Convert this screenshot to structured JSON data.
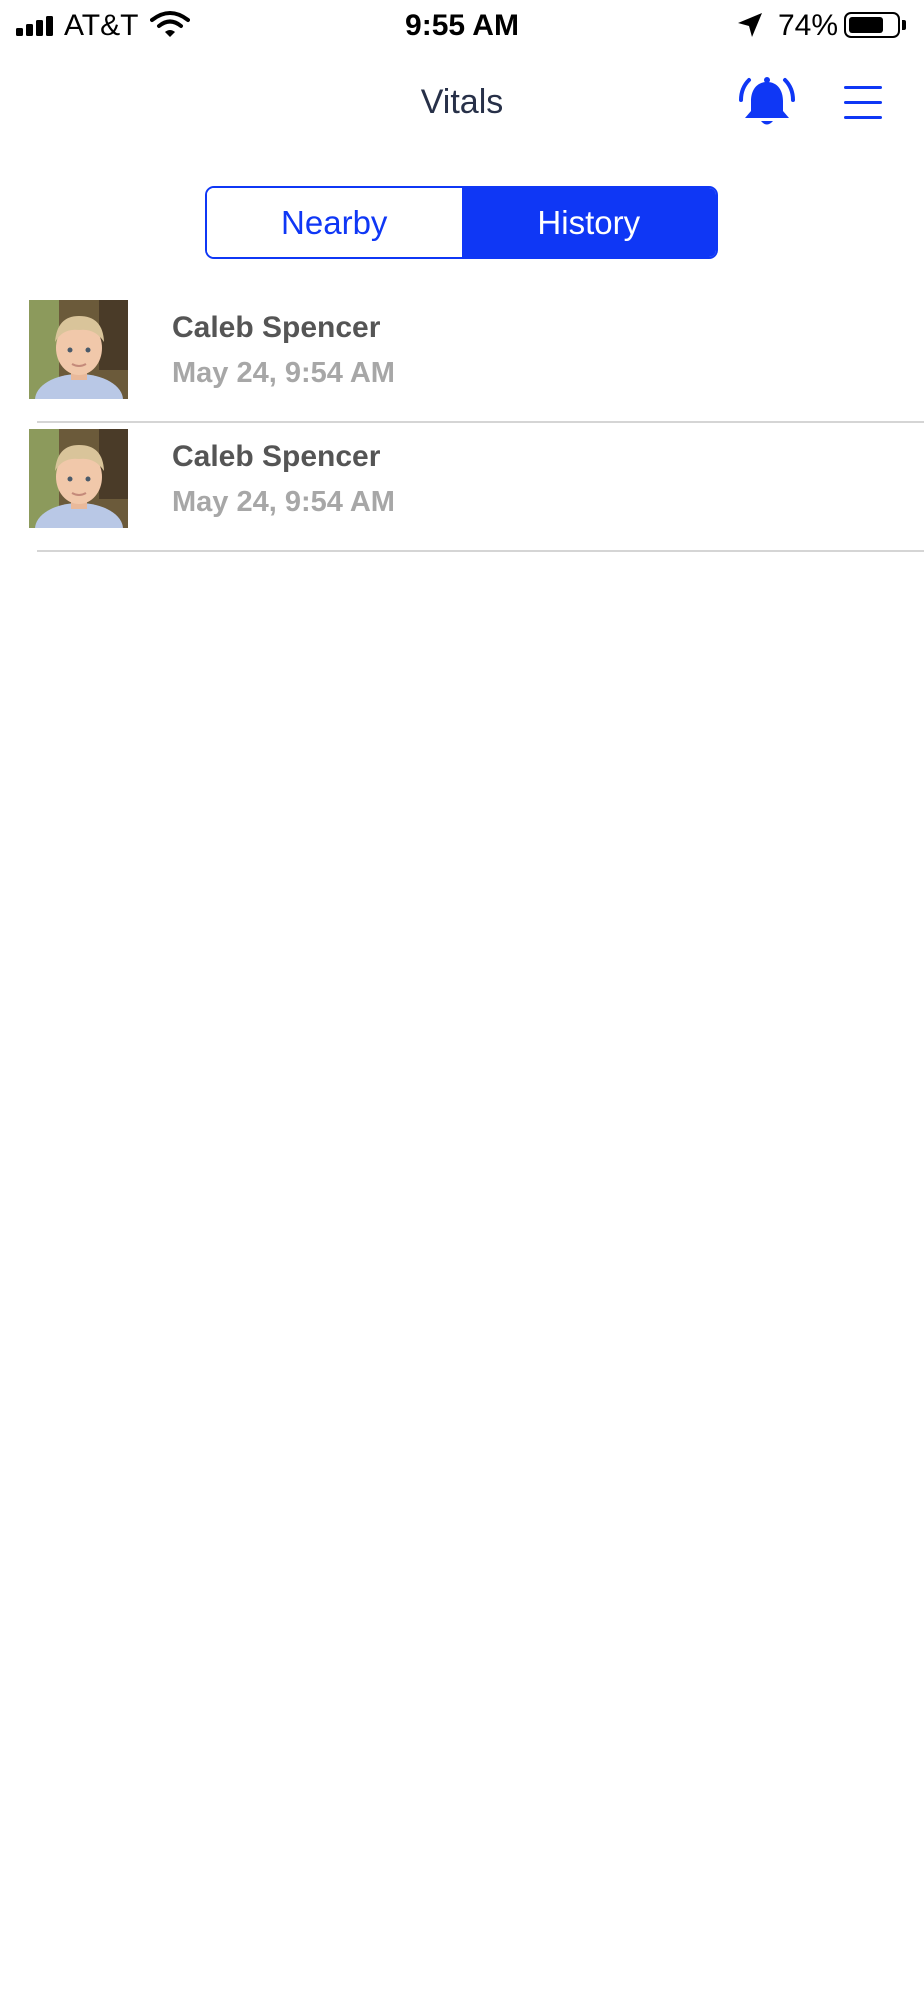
{
  "status_bar": {
    "carrier": "AT&T",
    "time": "9:55 AM",
    "battery_percent": "74%",
    "battery_level": 0.74,
    "icons": [
      "signal-icon",
      "wifi-icon",
      "location-arrow-icon",
      "battery-icon"
    ]
  },
  "nav": {
    "title": "Vitals",
    "bell_icon": "alarm-bell-icon",
    "menu_icon": "hamburger-menu-icon"
  },
  "segments": {
    "nearby_label": "Nearby",
    "history_label": "History",
    "selected": "History"
  },
  "history": [
    {
      "name": "Caleb Spencer",
      "time": "May 24, 9:54 AM"
    },
    {
      "name": "Caleb Spencer",
      "time": "May 24, 9:54 AM"
    }
  ],
  "colors": {
    "accent": "#0f37f5",
    "title_text": "#273048",
    "name_text": "#555555",
    "time_text": "#a7a7a7",
    "divider": "#d5d5d5"
  }
}
